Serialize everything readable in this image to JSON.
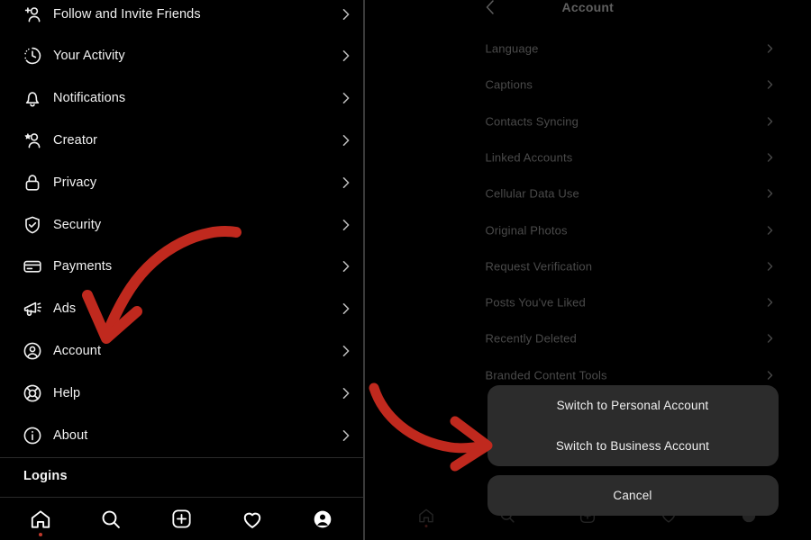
{
  "left_panel": {
    "menu_items": [
      {
        "label": "Follow and Invite Friends",
        "icon": "person-add-icon"
      },
      {
        "label": "Your Activity",
        "icon": "clock-activity-icon"
      },
      {
        "label": "Notifications",
        "icon": "bell-icon"
      },
      {
        "label": "Creator",
        "icon": "person-star-icon"
      },
      {
        "label": "Privacy",
        "icon": "lock-icon"
      },
      {
        "label": "Security",
        "icon": "shield-check-icon"
      },
      {
        "label": "Payments",
        "icon": "credit-card-icon"
      },
      {
        "label": "Ads",
        "icon": "megaphone-icon"
      },
      {
        "label": "Account",
        "icon": "account-circle-icon"
      },
      {
        "label": "Help",
        "icon": "life-ring-icon"
      },
      {
        "label": "About",
        "icon": "info-circle-icon"
      }
    ],
    "section_header": "Logins",
    "tabbar": [
      {
        "icon": "home-icon",
        "active": true
      },
      {
        "icon": "search-icon",
        "active": false
      },
      {
        "icon": "add-post-icon",
        "active": false
      },
      {
        "icon": "heart-icon",
        "active": false
      },
      {
        "icon": "profile-icon",
        "active": false
      }
    ]
  },
  "right_panel": {
    "header": {
      "title": "Account",
      "back_icon": "back-chevron-icon"
    },
    "account_items": [
      "Language",
      "Captions",
      "Contacts Syncing",
      "Linked Accounts",
      "Cellular Data Use",
      "Original Photos",
      "Request Verification",
      "Posts You've Liked",
      "Recently Deleted",
      "Branded Content Tools"
    ],
    "action_sheet": {
      "options": [
        "Switch to Personal Account",
        "Switch to Business Account"
      ],
      "cancel_label": "Cancel"
    }
  },
  "annotations": {
    "accent_color": "#c0291e",
    "arrows": [
      {
        "name": "arrow-to-account",
        "target": "Account"
      },
      {
        "name": "arrow-to-action-sheet",
        "target": "Switch to Business Account"
      }
    ]
  }
}
